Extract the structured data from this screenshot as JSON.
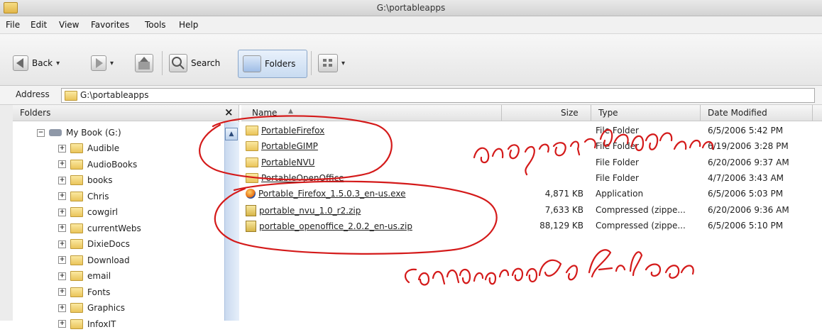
{
  "window": {
    "title": "G:\\portableapps"
  },
  "menu": [
    "File",
    "Edit",
    "View",
    "Favorites",
    "Tools",
    "Help"
  ],
  "toolbar": {
    "back": "Back",
    "search": "Search",
    "folders": "Folders"
  },
  "address": {
    "label": "Address",
    "value": "G:\\portableapps"
  },
  "folders_pane": {
    "title": "Folders",
    "close": "×",
    "root": "My Book (G:)",
    "items": [
      "Audible",
      "AudioBooks",
      "books",
      "Chris",
      "cowgirl",
      "currentWebs",
      "DixieDocs",
      "Download",
      "email",
      "Fonts",
      "Graphics",
      "InfoxIT"
    ]
  },
  "columns": {
    "name": "Name",
    "size": "Size",
    "type": "Type",
    "date": "Date Modified"
  },
  "files": [
    {
      "name": "PortableFirefox",
      "size": "",
      "type": "File Folder",
      "date": "6/5/2006 5:42 PM",
      "icon": "folder-icon"
    },
    {
      "name": "PortableGIMP",
      "size": "",
      "type": "File Folder",
      "date": "6/19/2006 3:28 PM",
      "icon": "folder-icon"
    },
    {
      "name": "PortableNVU",
      "size": "",
      "type": "File Folder",
      "date": "6/20/2006 9:37 AM",
      "icon": "folder-icon"
    },
    {
      "name": "PortableOpenOffice",
      "size": "",
      "type": "File Folder",
      "date": "4/7/2006 3:43 AM",
      "icon": "folder-icon"
    },
    {
      "name": "Portable_Firefox_1.5.0.3_en-us.exe",
      "size": "4,871 KB",
      "type": "Application",
      "date": "6/5/2006 5:03 PM",
      "icon": "firefox-icon"
    },
    {
      "name": "portable_nvu_1.0_r2.zip",
      "size": "7,633 KB",
      "type": "Compressed (zippe...",
      "date": "6/20/2006 9:36 AM",
      "icon": "zip-icon"
    },
    {
      "name": "portable_openoffice_2.0.2_en-us.zip",
      "size": "88,129 KB",
      "type": "Compressed (zippe...",
      "date": "6/5/2006 5:10 PM",
      "icon": "zip-icon"
    }
  ],
  "annotations": {
    "top": "program folders",
    "bottom": "compressed files"
  }
}
